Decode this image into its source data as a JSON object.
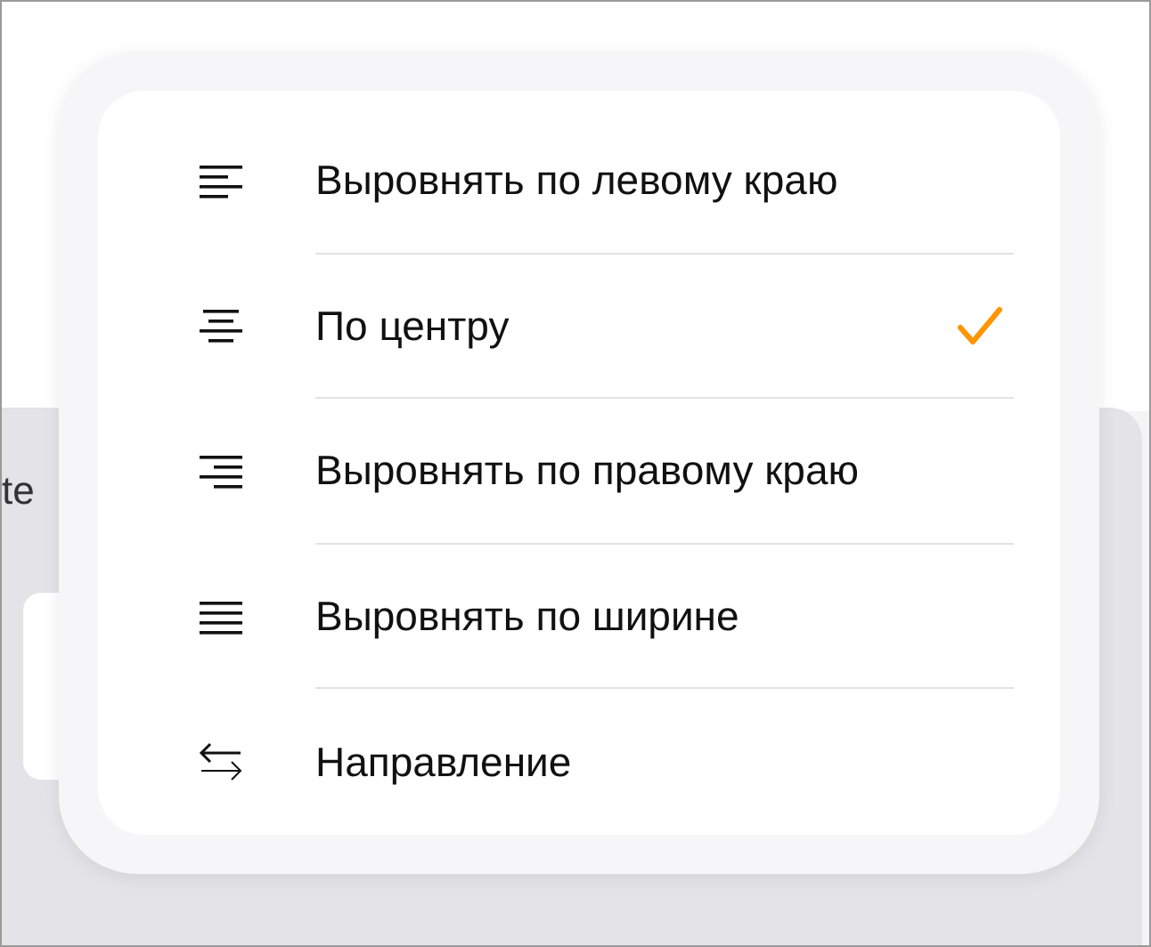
{
  "background": {
    "label": "te"
  },
  "menu": {
    "items": [
      {
        "kind": "left",
        "label": "Выровнять по левому краю",
        "selected": false
      },
      {
        "kind": "center",
        "label": "По центру",
        "selected": true
      },
      {
        "kind": "right",
        "label": "Выровнять по правому краю",
        "selected": false
      },
      {
        "kind": "justify",
        "label": "Выровнять по ширине",
        "selected": false
      },
      {
        "kind": "direction",
        "label": "Направление",
        "selected": false
      }
    ]
  }
}
